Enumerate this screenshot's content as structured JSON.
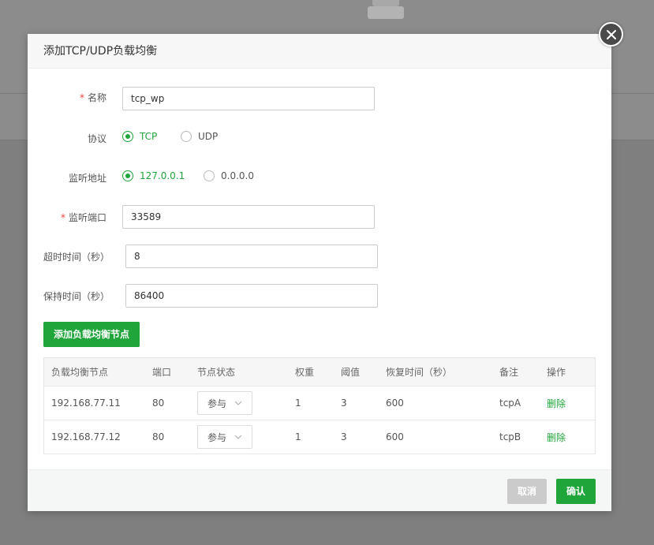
{
  "dialog": {
    "title": "添加TCP/UDP负载均衡"
  },
  "form": {
    "name": {
      "label": "名称",
      "required_mark": "*",
      "value": "tcp_wp"
    },
    "protocol": {
      "label": "协议",
      "options": [
        "TCP",
        "UDP"
      ],
      "selected": "TCP"
    },
    "listen_address": {
      "label": "监听地址",
      "options": [
        "127.0.0.1",
        "0.0.0.0"
      ],
      "selected": "127.0.0.1"
    },
    "listen_port": {
      "label": "监听端口",
      "required_mark": "*",
      "value": "33589"
    },
    "timeout": {
      "label": "超时时间（秒）",
      "value": "8"
    },
    "keepalive": {
      "label": "保持时间（秒）",
      "value": "86400"
    }
  },
  "add_node_button": "添加负载均衡节点",
  "table": {
    "columns": [
      "负载均衡节点",
      "端口",
      "节点状态",
      "权重",
      "阈值",
      "恢复时间（秒）",
      "备注",
      "操作"
    ],
    "rows": [
      {
        "node": "192.168.77.11",
        "port": "80",
        "status": "参与",
        "weight": "1",
        "threshold": "3",
        "recover": "600",
        "remark": "tcpA",
        "action": "删除"
      },
      {
        "node": "192.168.77.12",
        "port": "80",
        "status": "参与",
        "weight": "1",
        "threshold": "3",
        "recover": "600",
        "remark": "tcpB",
        "action": "删除"
      }
    ]
  },
  "footer": {
    "cancel": "取消",
    "confirm": "确认"
  },
  "colors": {
    "accent": "#20a53a",
    "required": "#f04134",
    "disabled": "#cbcbcb"
  }
}
